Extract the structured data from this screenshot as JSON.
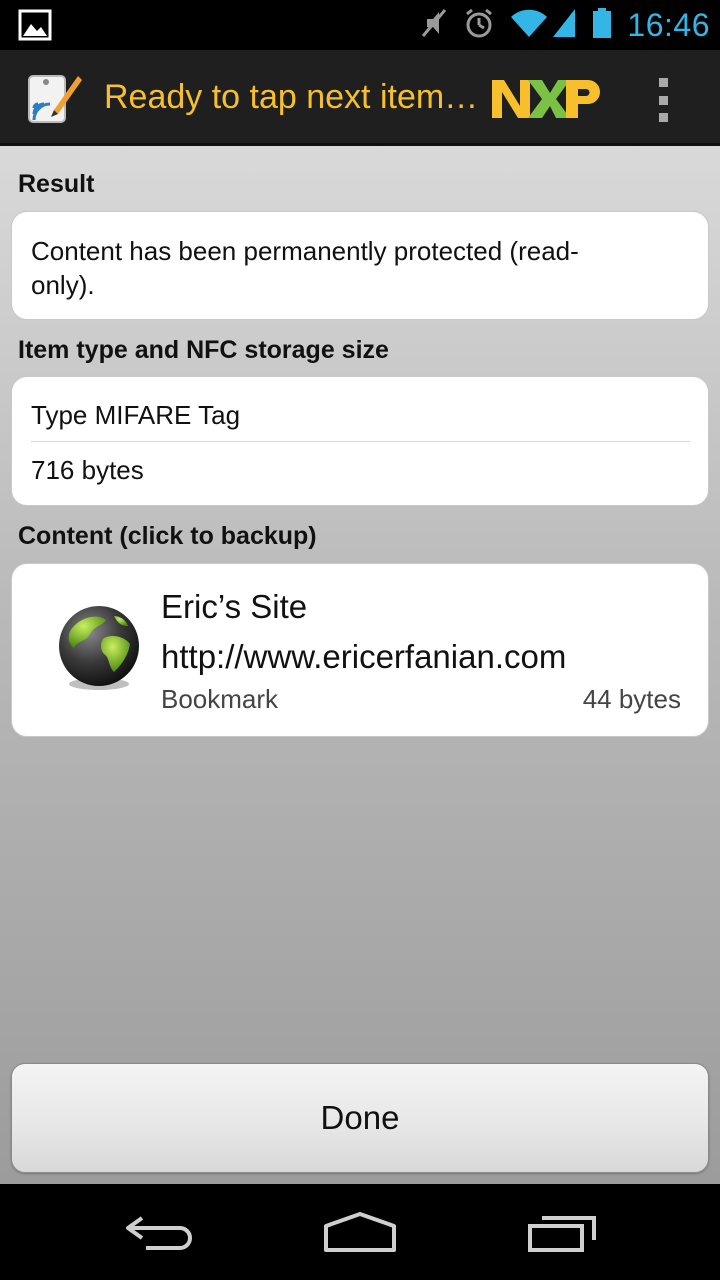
{
  "status_bar": {
    "time": "16:46",
    "icons": [
      "picture-icon",
      "mute-icon",
      "alarm-icon",
      "wifi-icon",
      "signal-icon",
      "battery-icon"
    ]
  },
  "action_bar": {
    "title": "Ready to tap next item…",
    "logo_name": "nxp-logo",
    "app_icon": "nfc-tag-writer-icon"
  },
  "result": {
    "label": "Result",
    "message_line1": "Content has been permanently protected (read-",
    "message_line2": "only)."
  },
  "item_type": {
    "label": "Item type and NFC storage size",
    "type": "Type MIFARE Tag",
    "size": "716 bytes"
  },
  "content": {
    "label": "Content (click to backup)",
    "item": {
      "title": "Eric’s Site",
      "url": "http://www.ericerfanian.com",
      "kind": "Bookmark",
      "size": "44 bytes",
      "icon": "globe-icon"
    }
  },
  "done_button": {
    "label": "Done"
  },
  "nav_bar": {
    "icons": [
      "back-icon",
      "home-icon",
      "recent-apps-icon"
    ]
  },
  "colors": {
    "title": "#f7bf2b",
    "status_accent": "#33b5e5",
    "action_bar_bg": "#1f1f1f"
  }
}
